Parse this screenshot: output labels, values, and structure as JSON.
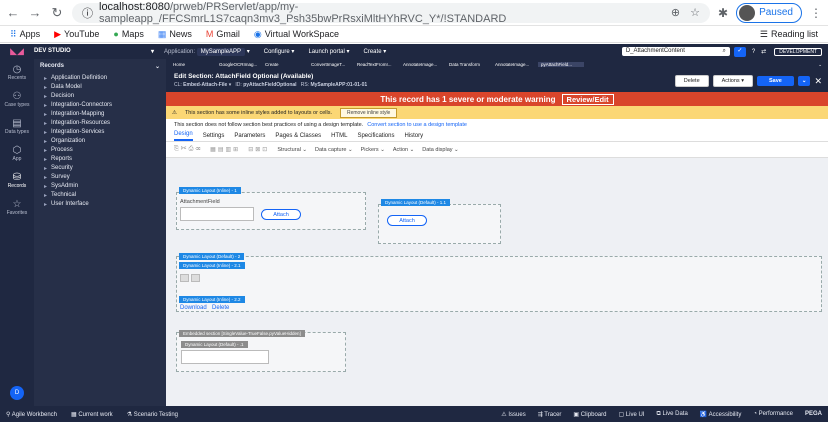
{
  "browser": {
    "url_host": "localhost:8080",
    "url_path": "/prweb/PRServlet/app/my-sampleapp_/FFCSmrL1S7caqn3mv3_Psh35bwPrRsxiMltHYhRVC_Y*/!STANDARD",
    "profile_label": "Paused",
    "bookmarks": [
      "Apps",
      "YouTube",
      "Maps",
      "News",
      "Gmail",
      "Virtual WorkSpace"
    ],
    "reading_list": "Reading list"
  },
  "pega_top": {
    "studio": "DEV STUDIO",
    "application_label": "Application:",
    "application": "MySampleAPP",
    "menus": [
      "Configure",
      "Launch portal",
      "Create"
    ],
    "search_value": "D_AttachmentContent",
    "env_badge": "DEVELOPMENT"
  },
  "rail": [
    {
      "label": "Recents",
      "icon": "clock-icon"
    },
    {
      "label": "Case types",
      "icon": "case-icon"
    },
    {
      "label": "Data types",
      "icon": "data-icon"
    },
    {
      "label": "App",
      "icon": "app-icon"
    },
    {
      "label": "Records",
      "icon": "records-icon",
      "active": true
    },
    {
      "label": "Favorites",
      "icon": "star-icon"
    }
  ],
  "user_initial": "D",
  "explorer": {
    "title": "Records",
    "items": [
      "Application Definition",
      "Data Model",
      "Decision",
      "Integration-Connectors",
      "Integration-Mapping",
      "Integration-Resources",
      "Integration-Services",
      "Organization",
      "Process",
      "Reports",
      "Security",
      "Survey",
      "SysAdmin",
      "Technical",
      "User Interface"
    ]
  },
  "work_tabs": [
    "Home",
    "GoogleOCRImag...",
    "Create",
    "ConvertImageT...",
    "ReadTextFromI...",
    "AnnotateImage...",
    "Data Transform",
    "AnnotateImage...",
    "pyAttachField..."
  ],
  "rule": {
    "title": "Edit  Section: AttachField Optional (Available)",
    "cl_label": "CL:",
    "cl_value": "Embed-Attach-File",
    "id_label": "ID:",
    "id_value": "pyAttachFieldOptional",
    "rs_label": "RS:",
    "rs_value": "MySampleAPP:01-01-01",
    "delete": "Delete",
    "actions": "Actions",
    "save": "Save"
  },
  "warning": {
    "text": "This record has 1 severe or moderate warning",
    "button": "Review/Edit"
  },
  "inline_warning": {
    "text": "This section has some inline styles added to layouts or cells.",
    "button": "Remove inline style"
  },
  "template_notice": {
    "text": "This section does not follow section best practices of using a design template.",
    "link": "Convert section to use a design template"
  },
  "rule_tabs": [
    "Design",
    "Settings",
    "Parameters",
    "Pages & Classes",
    "HTML",
    "Specifications",
    "History"
  ],
  "toolbar_menus": [
    "Structural",
    "Data capture",
    "Pickers",
    "Action",
    "Data display"
  ],
  "canvas": {
    "dl1": "Dynamic Layout (Inline) -   1",
    "attachment_label": "AttachmentField",
    "attach": "Attach",
    "dl11": "Dynamic Layout (Default) -   1.1",
    "attach2": "Attach",
    "dl2": "Dynamic Layout (Default) -   2",
    "dl21": "Dynamic Layout (Inline) -   2.1",
    "dl22": "Dynamic Layout (Inline) -   2.2",
    "download": "Download",
    "delete": "Delete",
    "embedded": "Embedded section [SingleValue-TrueFalse.pyValueHidden]",
    "dl_default": "Dynamic Layout (Default) -   .1"
  },
  "bottom": {
    "left": [
      "Agile Workbench",
      "Current work",
      "Scenario Testing"
    ],
    "right": [
      "Issues",
      "Tracer",
      "Clipboard",
      "Live UI",
      "Live Data",
      "Accessibility",
      "Performance",
      "PEGA"
    ]
  }
}
